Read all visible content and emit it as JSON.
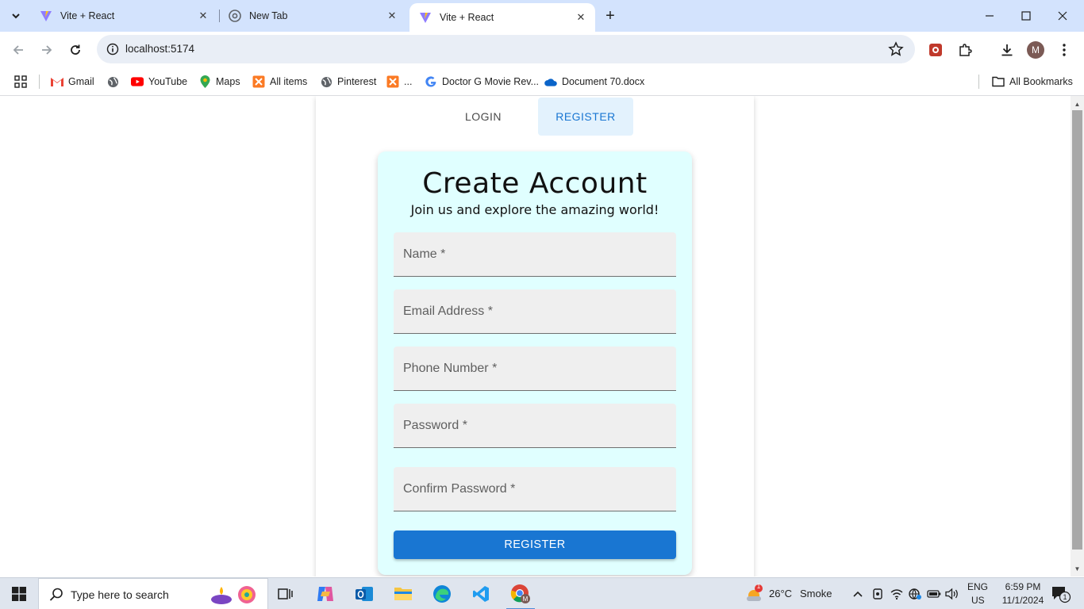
{
  "browser": {
    "tabs": [
      {
        "title": "Vite + React",
        "active": false
      },
      {
        "title": "New Tab",
        "active": false
      },
      {
        "title": "Vite + React",
        "active": true
      }
    ],
    "url": "localhost:5174",
    "profile_initial": "M",
    "bookmarks": [
      {
        "label": "Gmail",
        "icon": "gmail-icon"
      },
      {
        "label": "",
        "icon": "globe-icon"
      },
      {
        "label": "YouTube",
        "icon": "youtube-icon"
      },
      {
        "label": "Maps",
        "icon": "maps-icon"
      },
      {
        "label": "All items",
        "icon": "xampp-icon"
      },
      {
        "label": "Pinterest",
        "icon": "globe-icon"
      },
      {
        "label": "...",
        "icon": "xampp-icon"
      },
      {
        "label": "Doctor G Movie Rev...",
        "icon": "google-icon"
      },
      {
        "label": "Document 70.docx",
        "icon": "onedrive-icon"
      }
    ],
    "all_bookmarks_label": "All Bookmarks"
  },
  "page": {
    "tabs": {
      "login": "LOGIN",
      "register": "REGISTER"
    },
    "card": {
      "title": "Create Account",
      "subtitle": "Join us and explore the amazing world!",
      "fields": {
        "name": "Name *",
        "email": "Email Address *",
        "phone": "Phone Number *",
        "password": "Password *",
        "confirm": "Confirm Password *"
      },
      "submit_label": "REGISTER"
    }
  },
  "taskbar": {
    "search_placeholder": "Type here to search",
    "weather": {
      "temp": "26°C",
      "condition": "Smoke",
      "badge": "1"
    },
    "language": {
      "lang": "ENG",
      "region": "US"
    },
    "clock": {
      "time": "6:59 PM",
      "date": "11/1/2024"
    },
    "notification_count": "1"
  },
  "colors": {
    "tabstrip": "#d3e3fd",
    "accent": "#1976d2",
    "card_bg": "#e0ffff",
    "register_tab_bg": "#e3f2fd"
  }
}
